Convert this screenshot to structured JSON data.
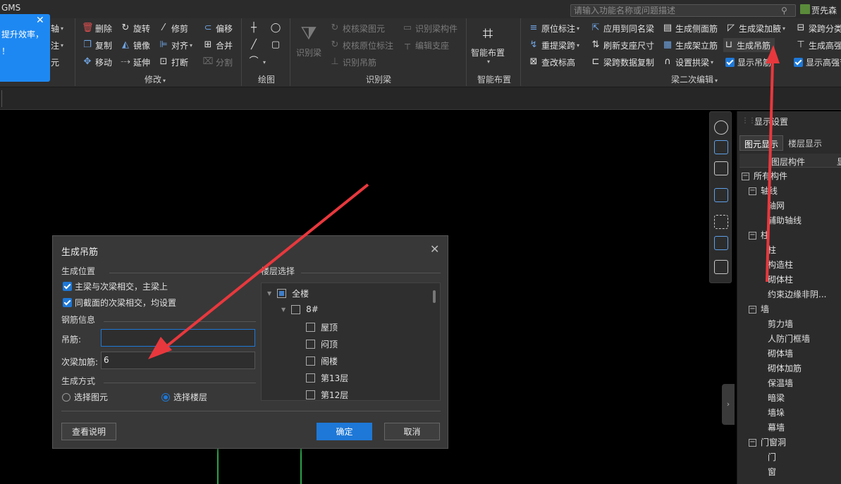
{
  "titlebar": {
    "app_title": "GMS",
    "search_placeholder": "请输入功能名称或问题描述",
    "user_name": "贾先森"
  },
  "notification": {
    "line1": "提升效率，",
    "line2": "！"
  },
  "ribbon": {
    "partial_left": {
      "axis": "轴",
      "annot": "注",
      "yuan": "元"
    },
    "modify": {
      "delete": "删除",
      "rotate": "旋转",
      "trim": "修剪",
      "offset": "偏移",
      "copy": "复制",
      "mirror": "镜像",
      "align": "对齐",
      "merge": "合并",
      "move": "移动",
      "extend": "延伸",
      "break": "打断",
      "split": "分割",
      "label": "修改"
    },
    "draw": {
      "label": "绘图"
    },
    "identify": {
      "big_label": "识别梁",
      "check_beam": "校核梁图元",
      "check_origin": "校核原位标注",
      "identify_hanger": "识别吊筋",
      "identify_component": "识别梁构件",
      "edit_support": "编辑支座",
      "label": "识别梁"
    },
    "smart": {
      "big_label": "智能布置",
      "label": "智能布置"
    },
    "secondary": {
      "origin_annot": "原位标注",
      "apply_same": "应用到同名梁",
      "gen_side": "生成侧面筋",
      "gen_haunch": "生成梁加腋",
      "span_class": "梁跨分类",
      "re_extract": "重提梁跨",
      "refresh_support": "刷新支座尺寸",
      "gen_stand": "生成架立筋",
      "gen_hanger": "生成吊筋",
      "gen_height": "生成高强",
      "check_elev": "查改标高",
      "span_copy": "梁跨数据复制",
      "set_arch": "设置拱梁",
      "show_hanger": "显示吊筋",
      "show_height": "显示高强节",
      "label": "梁二次编辑"
    }
  },
  "panel": {
    "title": "显示设置",
    "tab_element": "图元显示",
    "tab_floor": "楼层显示",
    "col_component": "图层构件",
    "col_show": "显",
    "tree": [
      {
        "label": "所有构件",
        "level": 0,
        "box": "−"
      },
      {
        "label": "轴线",
        "level": 1,
        "box": "−"
      },
      {
        "label": "轴网",
        "level": 2
      },
      {
        "label": "辅助轴线",
        "level": 2
      },
      {
        "label": "柱",
        "level": 1,
        "box": "−"
      },
      {
        "label": "柱",
        "level": 2
      },
      {
        "label": "构造柱",
        "level": 2
      },
      {
        "label": "砌体柱",
        "level": 2
      },
      {
        "label": "约束边缘非阴...",
        "level": 2
      },
      {
        "label": "墙",
        "level": 1,
        "box": "−"
      },
      {
        "label": "剪力墙",
        "level": 2
      },
      {
        "label": "人防门框墙",
        "level": 2
      },
      {
        "label": "砌体墙",
        "level": 2
      },
      {
        "label": "砌体加筋",
        "level": 2
      },
      {
        "label": "保温墙",
        "level": 2
      },
      {
        "label": "暗梁",
        "level": 2
      },
      {
        "label": "墙垛",
        "level": 2
      },
      {
        "label": "幕墙",
        "level": 2
      },
      {
        "label": "门窗洞",
        "level": 1,
        "box": "−"
      },
      {
        "label": "门",
        "level": 2
      },
      {
        "label": "窗",
        "level": 2
      }
    ]
  },
  "dialog": {
    "title": "生成吊筋",
    "position_section": "生成位置",
    "opt_main_secondary": "主梁与次梁相交，主梁上",
    "opt_same_section": "同截面的次梁相交，均设置",
    "rebar_section": "钢筋信息",
    "hanger_label": "吊筋:",
    "hanger_value": "",
    "secondary_label": "次梁加筋:",
    "secondary_value": "6",
    "method_section": "生成方式",
    "radio_element": "选择图元",
    "radio_floor": "选择楼层",
    "floor_section": "楼层选择",
    "floors": {
      "all": "全楼",
      "building": "8#",
      "items": [
        "屋顶",
        "闷顶",
        "阁楼",
        "第13层",
        "第12层"
      ]
    },
    "help_button": "查看说明",
    "ok_button": "确定",
    "cancel_button": "取消"
  },
  "colors": {
    "accent": "#1e78d7",
    "arrow": "#e8383d"
  }
}
